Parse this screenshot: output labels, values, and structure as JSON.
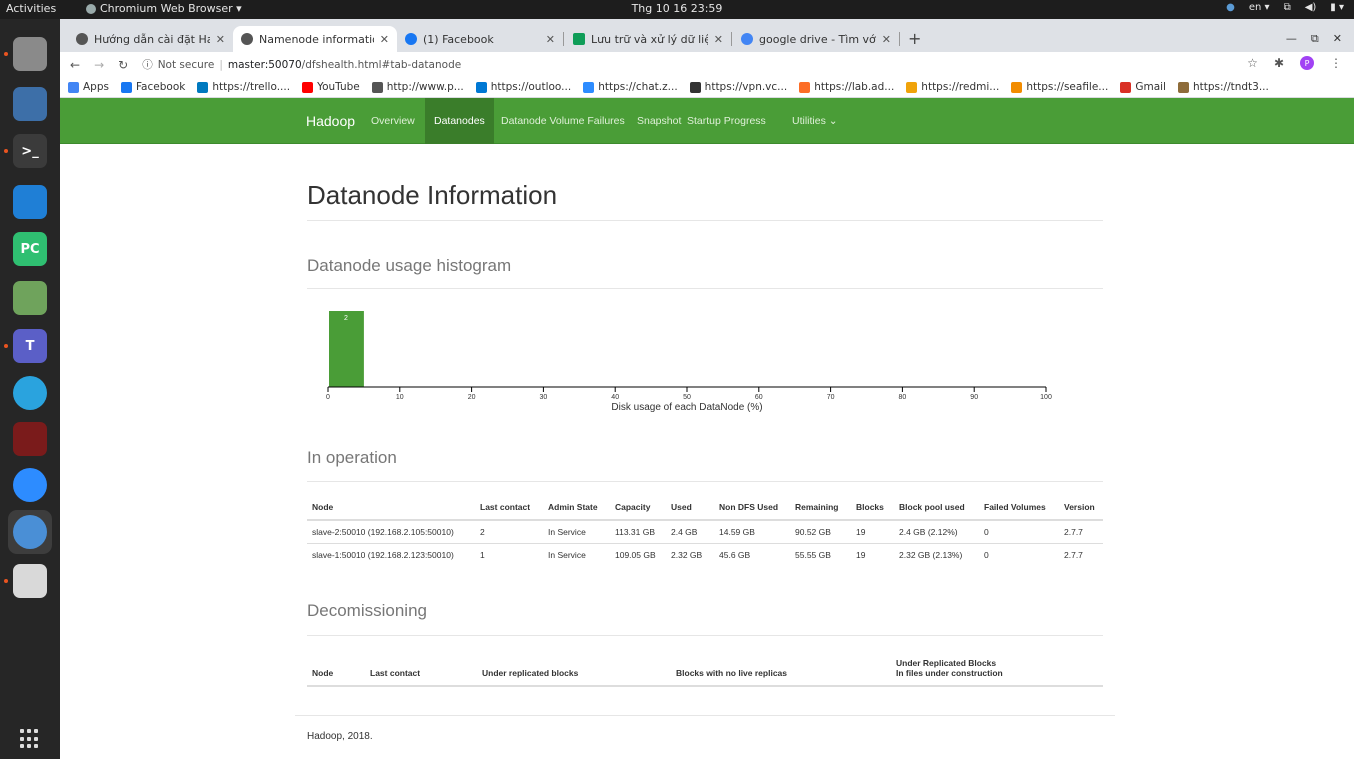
{
  "os": {
    "activities": "Activities",
    "app_menu": "Chromium Web Browser ▾",
    "clock": "Thg 10 16  23:59",
    "keyboard": "en ▾"
  },
  "dock": [
    {
      "name": "files",
      "color": "#8a8a8a",
      "label": ""
    },
    {
      "name": "document-viewer",
      "color": "#3d6fa8",
      "label": ""
    },
    {
      "name": "terminal",
      "color": "#3b3b3b",
      "label": ">_"
    },
    {
      "name": "vscode",
      "color": "#1f7fd6",
      "label": ""
    },
    {
      "name": "pycharm",
      "color": "#2fbf71",
      "label": "PC"
    },
    {
      "name": "lock-app",
      "color": "#6fa35c",
      "label": ""
    },
    {
      "name": "teams",
      "color": "#5b5fc7",
      "label": "T"
    },
    {
      "name": "telegram",
      "color": "#2aa3de",
      "label": ""
    },
    {
      "name": "wine",
      "color": "#7a1b1b",
      "label": ""
    },
    {
      "name": "zoom",
      "color": "#2d8cff",
      "label": ""
    },
    {
      "name": "chromium",
      "color": "#4a8fd6",
      "label": ""
    },
    {
      "name": "text-editor",
      "color": "#d9d9d9",
      "label": ""
    }
  ],
  "tabs": [
    {
      "title": "Hướng dẫn cài đặt Hado",
      "favicon": "#555"
    },
    {
      "title": "Namenode information",
      "favicon": "#555"
    },
    {
      "title": "(1) Facebook",
      "favicon": "#1877f2"
    },
    {
      "title": "Lưu trữ và xử lý dữ liệu lớ",
      "favicon": "#0f9d58"
    },
    {
      "title": "google drive - Tìm với Goo",
      "favicon": "#4285f4"
    }
  ],
  "omnibox": {
    "security": "Not secure",
    "host": "master:50070",
    "path": "/dfshealth.html#tab-datanode"
  },
  "bookmarks": [
    {
      "label": "Apps",
      "color": "#4285f4"
    },
    {
      "label": "Facebook",
      "color": "#1877f2"
    },
    {
      "label": "https://trello....",
      "color": "#0079bf"
    },
    {
      "label": "YouTube",
      "color": "#ff0000"
    },
    {
      "label": "http://www.p...",
      "color": "#555"
    },
    {
      "label": "https://outloo...",
      "color": "#0078d4"
    },
    {
      "label": "https://chat.z...",
      "color": "#2d8cff"
    },
    {
      "label": "https://vpn.vc...",
      "color": "#333"
    },
    {
      "label": "https://lab.ad...",
      "color": "#fc6d26"
    },
    {
      "label": "https://redmi...",
      "color": "#f0a30a"
    },
    {
      "label": "https://seafile...",
      "color": "#f28c00"
    },
    {
      "label": "Gmail",
      "color": "#d93025"
    },
    {
      "label": "https://tndt3...",
      "color": "#8e6c3a"
    }
  ],
  "hadoop_nav": {
    "brand": "Hadoop",
    "items": [
      "Overview",
      "Datanodes",
      "Datanode Volume Failures",
      "Snapshot",
      "Startup Progress",
      "Utilities ⌄"
    ],
    "active": "Datanodes"
  },
  "page": {
    "title": "Datanode Information",
    "histogram_heading": "Datanode usage histogram",
    "in_operation_heading": "In operation",
    "decommissioning_heading": "Decomissioning",
    "footer": "Hadoop, 2018."
  },
  "chart_data": {
    "type": "bar",
    "bins": [
      {
        "x_start": 0,
        "x_end": 5,
        "count": 2
      }
    ],
    "bin_labels": [
      "2"
    ],
    "xlim": [
      0,
      100
    ],
    "ylim": [
      0,
      2
    ],
    "x_ticks": [
      0,
      10,
      20,
      30,
      40,
      50,
      60,
      70,
      80,
      90,
      100
    ],
    "xlabel": "Disk usage of each DataNode (%)",
    "bar_color": "#4a9d37"
  },
  "in_operation": {
    "columns": [
      "Node",
      "Last contact",
      "Admin State",
      "Capacity",
      "Used",
      "Non DFS Used",
      "Remaining",
      "Blocks",
      "Block pool used",
      "Failed Volumes",
      "Version"
    ],
    "rows": [
      [
        "slave-2:50010 (192.168.2.105:50010)",
        "2",
        "In Service",
        "113.31 GB",
        "2.4 GB",
        "14.59 GB",
        "90.52 GB",
        "19",
        "2.4 GB (2.12%)",
        "0",
        "2.7.7"
      ],
      [
        "slave-1:50010 (192.168.2.123:50010)",
        "1",
        "In Service",
        "109.05 GB",
        "2.32 GB",
        "45.6 GB",
        "55.55 GB",
        "19",
        "2.32 GB (2.13%)",
        "0",
        "2.7.7"
      ]
    ]
  },
  "decommissioning": {
    "columns": [
      "Node",
      "Last contact",
      "Under replicated blocks",
      "Blocks with no live replicas",
      "Under Replicated Blocks",
      "In files under construction"
    ]
  }
}
